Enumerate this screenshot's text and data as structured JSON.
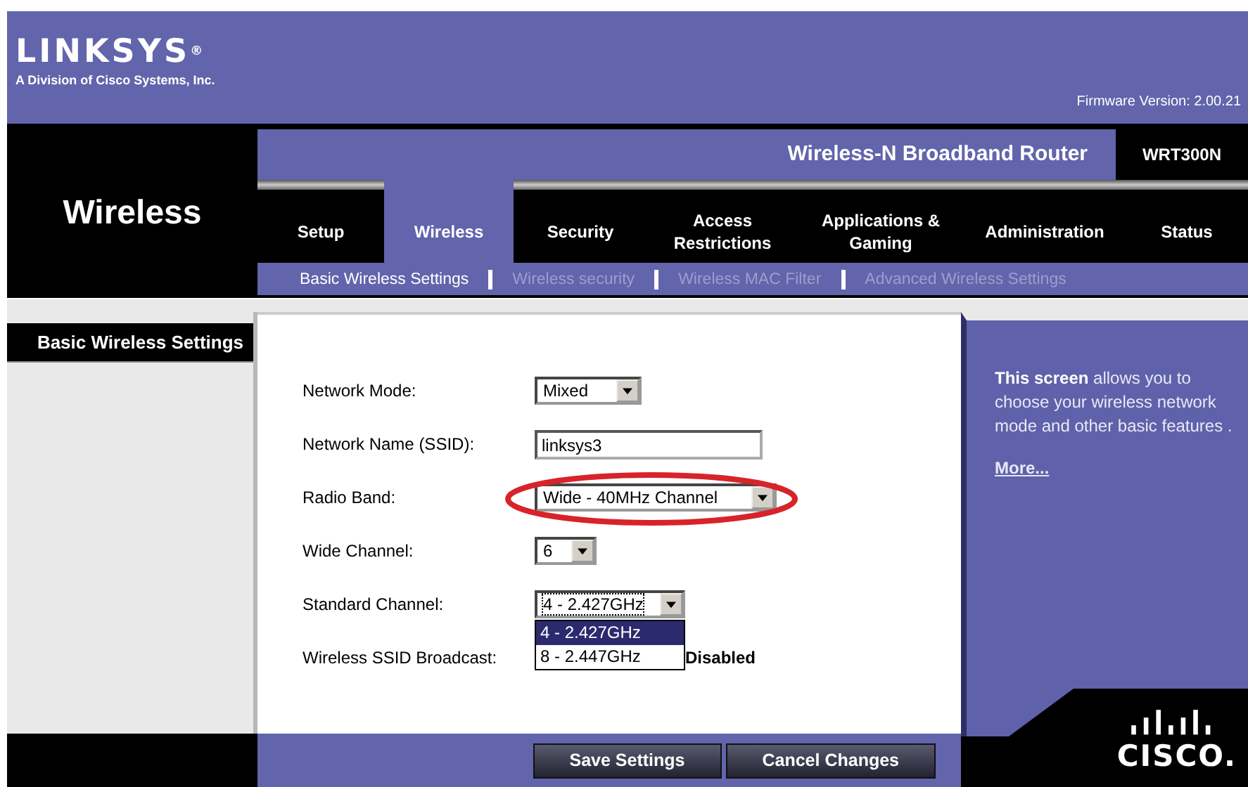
{
  "header": {
    "logo": "LINKSYS$^{®}$",
    "logo_subtitle": "A Division of Cisco Systems, Inc.",
    "firmware": "Firmware Version: 2.00.21"
  },
  "section_title": "Wireless",
  "product": {
    "name": "Wireless-N Broadband Router",
    "model": "WRT300N"
  },
  "tabs": [
    {
      "label": "Setup",
      "selected": false
    },
    {
      "label": "Wireless",
      "selected": true
    },
    {
      "label": "Security",
      "selected": false
    },
    {
      "label": "Access Restrictions",
      "selected": false
    },
    {
      "label": "Applications & Gaming",
      "selected": false
    },
    {
      "label": "Administration",
      "selected": false
    },
    {
      "label": "Status",
      "selected": false
    }
  ],
  "subtabs": [
    {
      "label": "Basic Wireless Settings",
      "selected": true
    },
    {
      "label": "Wireless security",
      "selected": false
    },
    {
      "label": "Wireless MAC Filter",
      "selected": false
    },
    {
      "label": "Advanced Wireless Settings",
      "selected": false
    }
  ],
  "sidebar": {
    "heading": "Basic Wireless Settings"
  },
  "form": [
    {
      "kind": "select",
      "label": "Network Mode:",
      "value": "Mixed"
    },
    {
      "kind": "text",
      "label": "Network Name (SSID):",
      "value": "linksys3"
    },
    {
      "kind": "select",
      "label": "Radio Band:",
      "value": "Wide - 40MHz Channel",
      "highlighted": true
    },
    {
      "kind": "select",
      "label": "Wide Channel:",
      "value": "6"
    },
    {
      "kind": "select",
      "label": "Standard Channel:",
      "value": "4 - 2.427GHz",
      "expanded": true,
      "options": [
        {
          "label": "4 - 2.427GHz",
          "selected": true
        },
        {
          "label": "8 - 2.447GHz",
          "selected": false
        }
      ]
    },
    {
      "kind": "radio",
      "label": "Wireless SSID Broadcast:",
      "value": "Disabled"
    }
  ],
  "help": {
    "text": "**This screen** allows you to choose your wireless network mode and other basic features .",
    "link": "More..."
  },
  "brand": {
    "logo": "CISCO."
  },
  "buttons": [
    "Save Settings",
    "Cancel Changes"
  ]
}
